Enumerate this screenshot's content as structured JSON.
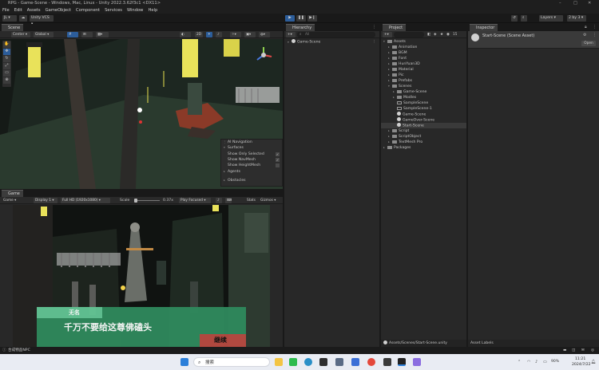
{
  "window": {
    "title": "RPG - Game-Scene - Windows, Mac, Linux - Unity 2022.3.62f3c1 <DX11>"
  },
  "menu": [
    "File",
    "Edit",
    "Assets",
    "GameObject",
    "Component",
    "Services",
    "Window",
    "Help"
  ],
  "toolbar": {
    "account": "JL",
    "vcs": "Unity VCS",
    "layers": "Layers",
    "layout": "2 by 3"
  },
  "scene": {
    "tab": "Scene",
    "center": "Center",
    "global": "Global",
    "mode_2d": "2D",
    "nav": {
      "title": "AI Navigation",
      "section": "Surfaces",
      "options": [
        {
          "label": "Show Only Selected",
          "checked": true
        },
        {
          "label": "Show NavMesh",
          "checked": true
        },
        {
          "label": "Show HeightMesh",
          "checked": false
        }
      ],
      "agents": "Agents",
      "obstacles": "Obstacles"
    }
  },
  "game": {
    "tab": "Game",
    "mode": "Game",
    "display": "Display 1",
    "resolution": "Full HD (1920x1080)",
    "scale_label": "Scale",
    "scale_value": "0.37x",
    "play_focused": "Play Focused",
    "stats": "Stats",
    "gizmos": "Gizmos",
    "dialog": {
      "speaker": "无名",
      "line": "千万不要给这尊佛磕头",
      "continue": "继续"
    }
  },
  "hierarchy": {
    "tab": "Hierarchy",
    "search_placeholder": "All",
    "root": "Game-Scene"
  },
  "project": {
    "tab": "Project",
    "count": "15",
    "tree": [
      {
        "label": "Assets",
        "depth": 0,
        "expanded": true,
        "kind": "folder"
      },
      {
        "label": "Animation",
        "depth": 1,
        "kind": "folder"
      },
      {
        "label": "BGM",
        "depth": 1,
        "kind": "folder"
      },
      {
        "label": "Font",
        "depth": 1,
        "kind": "folder"
      },
      {
        "label": "HunYuan3D",
        "depth": 1,
        "kind": "folder"
      },
      {
        "label": "Material",
        "depth": 1,
        "kind": "folder"
      },
      {
        "label": "Pic",
        "depth": 1,
        "kind": "folder"
      },
      {
        "label": "Prefabs",
        "depth": 1,
        "kind": "folder"
      },
      {
        "label": "Scenes",
        "depth": 1,
        "expanded": true,
        "kind": "folder"
      },
      {
        "label": "Game-Scene",
        "depth": 2,
        "kind": "folder"
      },
      {
        "label": "Modles",
        "depth": 2,
        "kind": "folder"
      },
      {
        "label": "SampleScene",
        "depth": 2,
        "kind": "file"
      },
      {
        "label": "SampleScene-1",
        "depth": 2,
        "kind": "file"
      },
      {
        "label": "Game-Scene",
        "depth": 2,
        "kind": "scene"
      },
      {
        "label": "GameOver-Scene",
        "depth": 2,
        "kind": "scene"
      },
      {
        "label": "Start-Scene",
        "depth": 2,
        "kind": "scene",
        "selected": true
      },
      {
        "label": "Script",
        "depth": 1,
        "kind": "folder"
      },
      {
        "label": "ScriptObject",
        "depth": 1,
        "kind": "folder"
      },
      {
        "label": "TextMesh Pro",
        "depth": 1,
        "kind": "folder"
      },
      {
        "label": "Packages",
        "depth": 0,
        "kind": "folder"
      }
    ],
    "footer_path": "Assets/Scenes/Start-Scene.unity"
  },
  "inspector": {
    "tab": "Inspector",
    "title": "Start-Scene (Scene Asset)",
    "open": "Open",
    "asset_labels": "Asset Labels"
  },
  "status": {
    "message": "合成物品NPC"
  },
  "taskbar": {
    "search": "搜索",
    "time": "11:21",
    "date": "2024/7/22",
    "battery": "90%"
  },
  "colors": {
    "accent_blue": "#2c5d9a",
    "dialog_green": "#2e8a5c",
    "dialog_name": "#4fbf86",
    "continue_red": "#b0463e",
    "lamp_yellow": "#e9e25a"
  }
}
